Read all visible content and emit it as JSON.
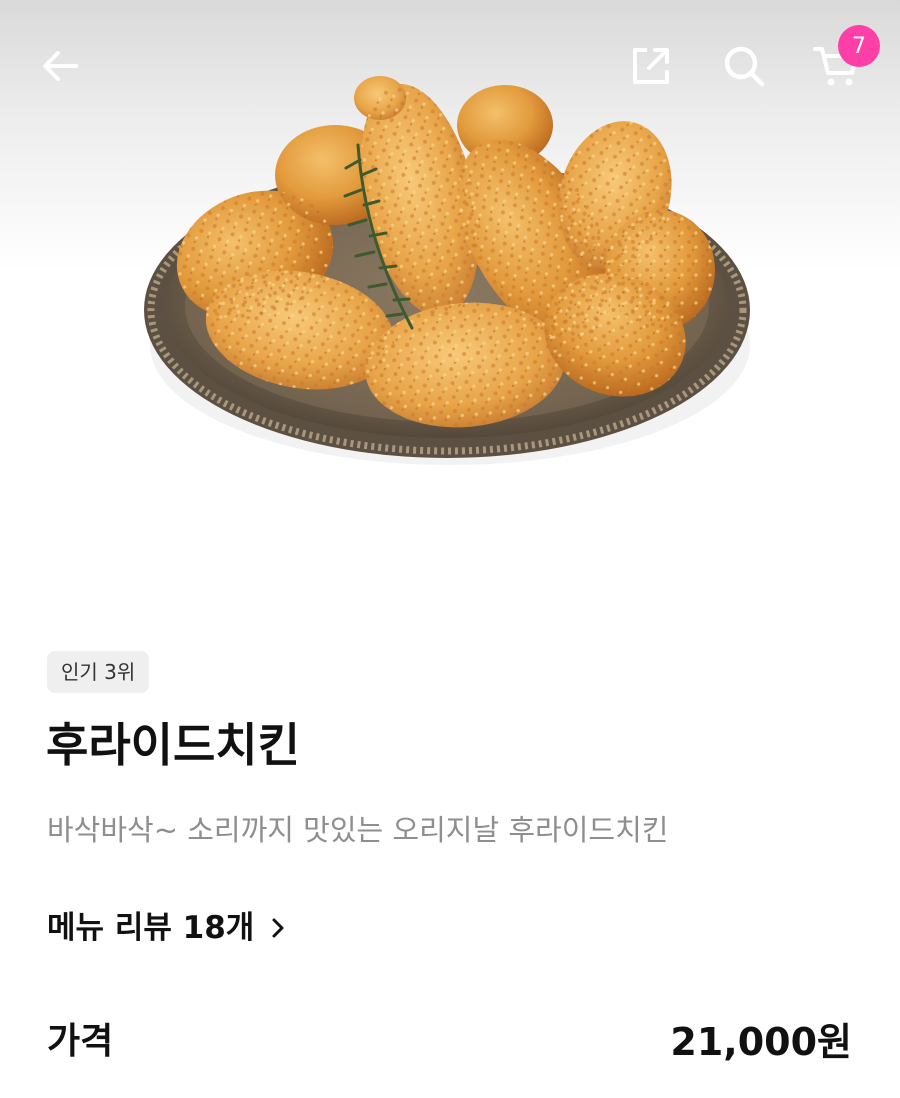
{
  "header": {
    "back_icon": "arrow-left-icon",
    "share_icon": "share-icon",
    "search_icon": "search-icon",
    "cart_icon": "cart-icon",
    "cart_count": "7"
  },
  "hero_image": {
    "subject": "fried-chicken-platter"
  },
  "product": {
    "rank_tag": "인기 3위",
    "name": "후라이드치킨",
    "description": "바삭바삭~ 소리까지 맛있는 오리지날 후라이드치킨",
    "review_link": "메뉴 리뷰 18개",
    "price_label": "가격",
    "price_value": "21,000원"
  },
  "colors": {
    "badge": "#ff3fa8",
    "text_primary": "#111111",
    "text_secondary": "#8e8e8e",
    "tag_bg": "#efefef"
  }
}
